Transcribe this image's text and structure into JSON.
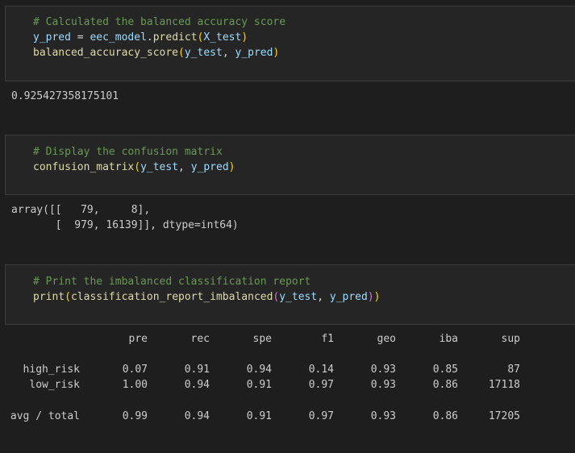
{
  "cells": [
    {
      "code": [
        {
          "parts": [
            {
              "t": "# Calculated the balanced accuracy score",
              "c": "comment"
            }
          ]
        },
        {
          "parts": [
            {
              "t": "y_pred",
              "c": "var"
            },
            {
              "t": " = ",
              "c": "punc"
            },
            {
              "t": "eec_model",
              "c": "var"
            },
            {
              "t": ".",
              "c": "punc"
            },
            {
              "t": "predict",
              "c": "fn"
            },
            {
              "t": "(",
              "c": "paren-y"
            },
            {
              "t": "X_test",
              "c": "var"
            },
            {
              "t": ")",
              "c": "paren-y"
            }
          ]
        },
        {
          "parts": [
            {
              "t": "balanced_accuracy_score",
              "c": "fn"
            },
            {
              "t": "(",
              "c": "paren-y"
            },
            {
              "t": "y_test",
              "c": "var"
            },
            {
              "t": ", ",
              "c": "punc"
            },
            {
              "t": "y_pred",
              "c": "var"
            },
            {
              "t": ")",
              "c": "paren-y"
            }
          ]
        }
      ],
      "output": [
        "0.925427358175101"
      ]
    },
    {
      "code": [
        {
          "parts": [
            {
              "t": "# Display the confusion matrix",
              "c": "comment"
            }
          ]
        },
        {
          "parts": [
            {
              "t": "confusion_matrix",
              "c": "fn"
            },
            {
              "t": "(",
              "c": "paren-y"
            },
            {
              "t": "y_test",
              "c": "var"
            },
            {
              "t": ", ",
              "c": "punc"
            },
            {
              "t": "y_pred",
              "c": "var"
            },
            {
              "t": ")",
              "c": "paren-y"
            }
          ]
        }
      ],
      "output": [
        "array([[   79,     8],",
        "       [  979, 16139]], dtype=int64)"
      ]
    },
    {
      "code": [
        {
          "parts": [
            {
              "t": "# Print the imbalanced classification report",
              "c": "comment"
            }
          ]
        },
        {
          "parts": [
            {
              "t": "print",
              "c": "fn"
            },
            {
              "t": "(",
              "c": "paren-y"
            },
            {
              "t": "classification_report_imbalanced",
              "c": "fn"
            },
            {
              "t": "(",
              "c": "paren-p"
            },
            {
              "t": "y_test",
              "c": "var"
            },
            {
              "t": ", ",
              "c": "punc"
            },
            {
              "t": "y_pred",
              "c": "var"
            },
            {
              "t": ")",
              "c": "paren-p"
            },
            {
              "t": ")",
              "c": "paren-y"
            }
          ]
        }
      ]
    }
  ],
  "report": {
    "headers": [
      "pre",
      "rec",
      "spe",
      "f1",
      "geo",
      "iba",
      "sup"
    ],
    "rows": [
      {
        "label": "high_risk",
        "values": [
          "0.07",
          "0.91",
          "0.94",
          "0.14",
          "0.93",
          "0.85",
          "87"
        ]
      },
      {
        "label": "low_risk",
        "values": [
          "1.00",
          "0.94",
          "0.91",
          "0.97",
          "0.93",
          "0.86",
          "17118"
        ]
      },
      {
        "label": "avg / total",
        "values": [
          "0.99",
          "0.94",
          "0.91",
          "0.97",
          "0.93",
          "0.86",
          "17205"
        ]
      }
    ]
  },
  "theme": {
    "background": "#1e1e1e",
    "cell_background": "#252526",
    "comment": "#6a9955",
    "function": "#dcdcaa",
    "variable": "#9cdcfe",
    "bracket_level1": "#ffd700",
    "bracket_level2": "#da70d6"
  }
}
